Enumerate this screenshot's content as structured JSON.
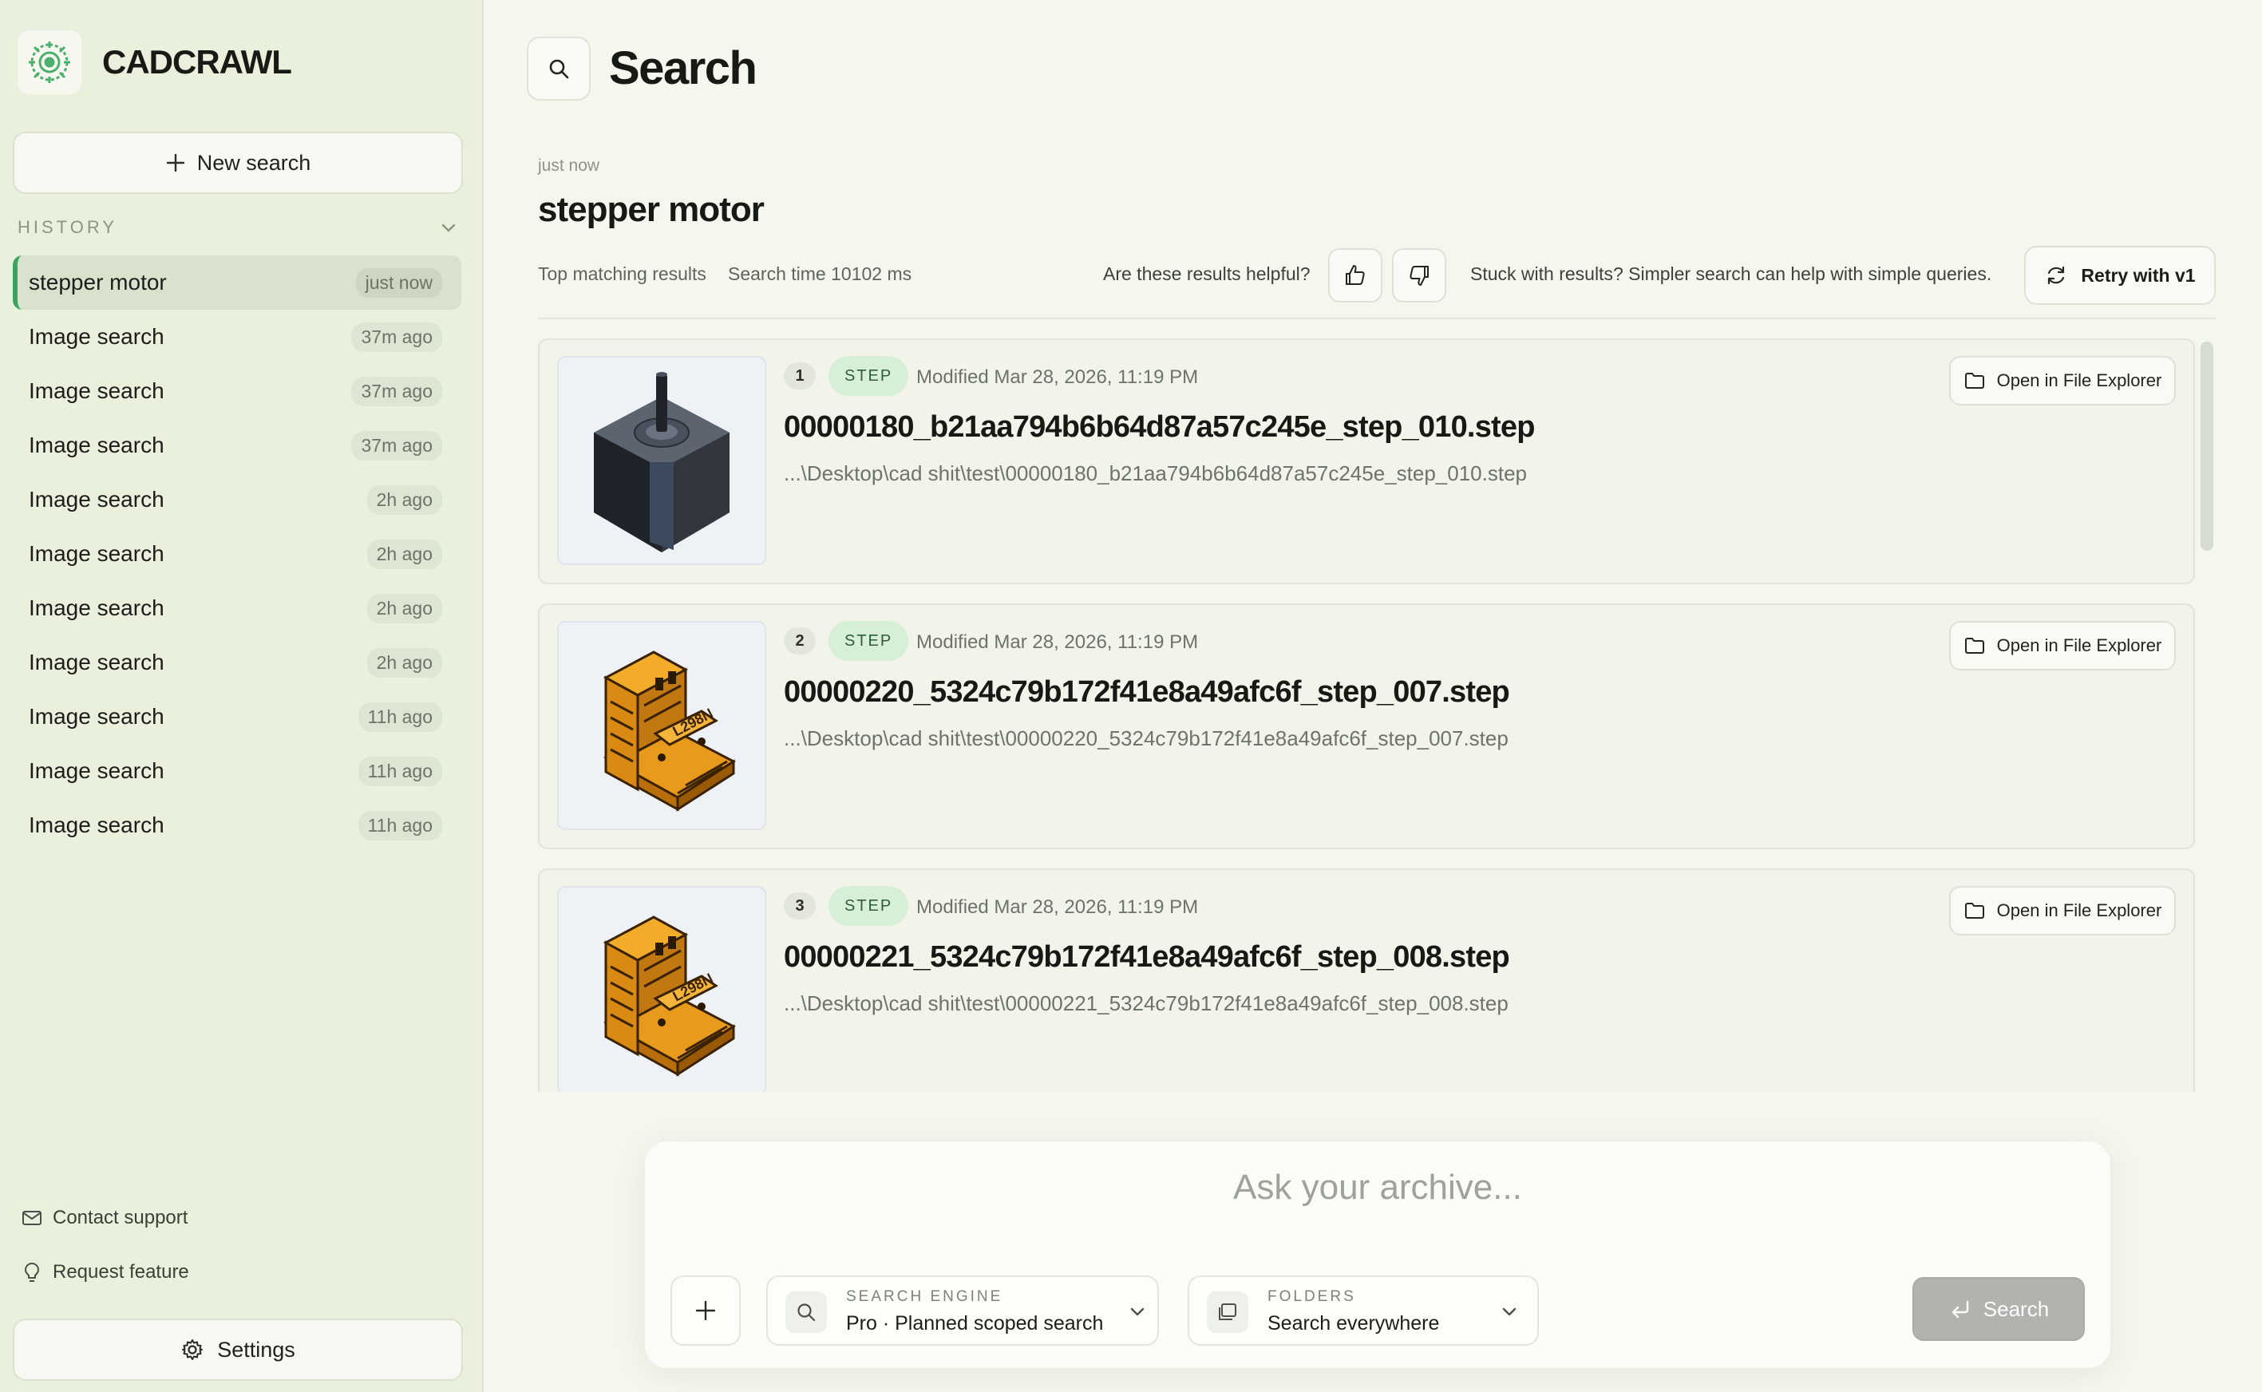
{
  "brand": {
    "name": "CADCRAWL",
    "logo_icon": "gear-leaf-logo-icon",
    "accent": "#3aa45c"
  },
  "sidebar": {
    "new_search_label": "New search",
    "history_label": "HISTORY",
    "history": [
      {
        "label": "stepper motor",
        "time": "just now",
        "active": true
      },
      {
        "label": "Image search",
        "time": "37m ago"
      },
      {
        "label": "Image search",
        "time": "37m ago"
      },
      {
        "label": "Image search",
        "time": "37m ago"
      },
      {
        "label": "Image search",
        "time": "2h ago"
      },
      {
        "label": "Image search",
        "time": "2h ago"
      },
      {
        "label": "Image search",
        "time": "2h ago"
      },
      {
        "label": "Image search",
        "time": "2h ago"
      },
      {
        "label": "Image search",
        "time": "11h ago"
      },
      {
        "label": "Image search",
        "time": "11h ago"
      },
      {
        "label": "Image search",
        "time": "11h ago"
      }
    ],
    "contact_support_label": "Contact support",
    "request_feature_label": "Request feature",
    "settings_label": "Settings"
  },
  "main": {
    "page_title": "Search",
    "query": {
      "time": "just now",
      "title": "stepper motor"
    },
    "meta": {
      "top_matching": "Top matching results",
      "search_time": "Search time 10102 ms",
      "helpful_question": "Are these results helpful?",
      "stuck_text": "Stuck with results? Simpler search can help with simple queries.",
      "retry_label": "Retry with v1"
    },
    "results": [
      {
        "rank": "1",
        "type": "STEP",
        "modified": "Modified Mar 28, 2026, 11:19 PM",
        "filename": "00000180_b21aa794b6b64d87a57c245e_step_010.step",
        "path": "...\\Desktop\\cad shit\\test\\00000180_b21aa794b6b64d87a57c245e_step_010.step",
        "open_label": "Open in File Explorer",
        "thumbnail": "stepper-motor"
      },
      {
        "rank": "2",
        "type": "STEP",
        "modified": "Modified Mar 28, 2026, 11:19 PM",
        "filename": "00000220_5324c79b172f41e8a49afc6f_step_007.step",
        "path": "...\\Desktop\\cad shit\\test\\00000220_5324c79b172f41e8a49afc6f_step_007.step",
        "open_label": "Open in File Explorer",
        "thumbnail": "driver-board"
      },
      {
        "rank": "3",
        "type": "STEP",
        "modified": "Modified Mar 28, 2026, 11:19 PM",
        "filename": "00000221_5324c79b172f41e8a49afc6f_step_008.step",
        "path": "...\\Desktop\\cad shit\\test\\00000221_5324c79b172f41e8a49afc6f_step_008.step",
        "open_label": "Open in File Explorer",
        "thumbnail": "driver-board"
      }
    ],
    "board_chip_text": "L298N"
  },
  "composer": {
    "placeholder": "Ask your archive...",
    "engine": {
      "caption": "SEARCH ENGINE",
      "value": "Pro · Planned scoped search"
    },
    "folders": {
      "caption": "FOLDERS",
      "value": "Search everywhere"
    },
    "submit_label": "Search"
  }
}
